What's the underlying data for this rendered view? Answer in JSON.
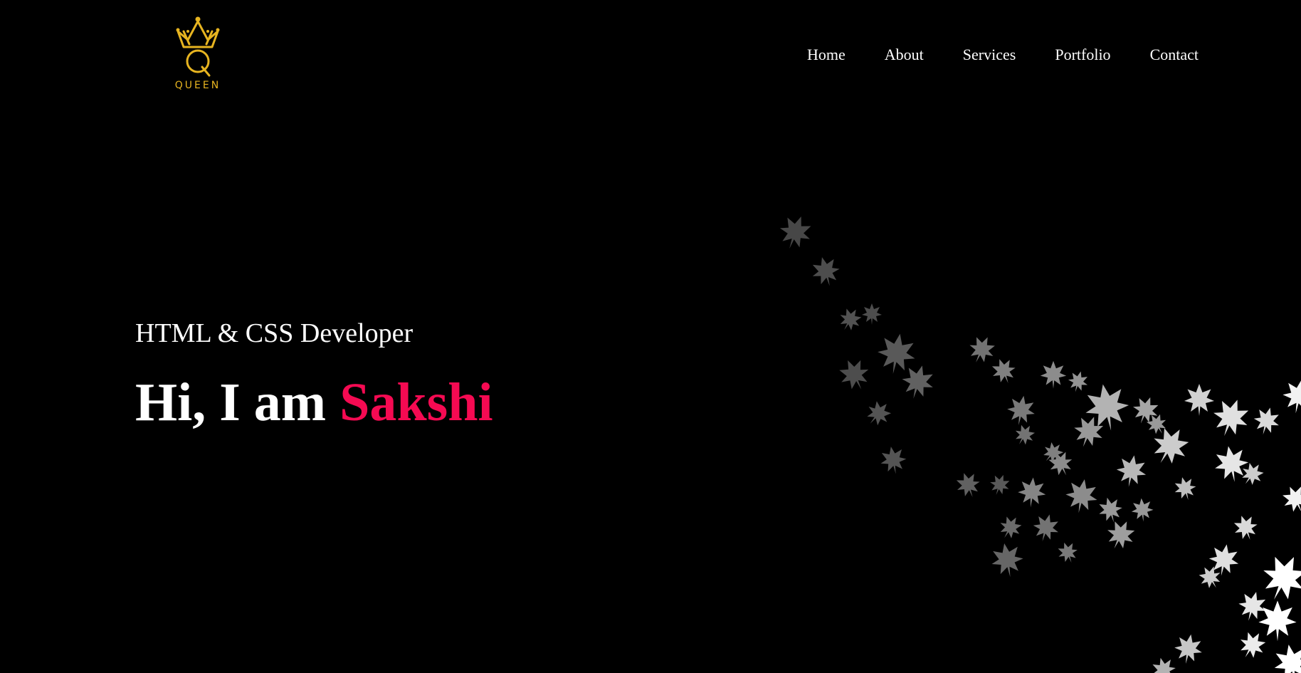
{
  "brand": {
    "logo_icon": "crown-q-icon",
    "logo_text": "QUEEN",
    "logo_color": "#e7b420"
  },
  "nav": {
    "items": [
      {
        "label": "Home"
      },
      {
        "label": "About"
      },
      {
        "label": "Services"
      },
      {
        "label": "Portfolio"
      },
      {
        "label": "Contact"
      }
    ]
  },
  "hero": {
    "subtitle": "HTML & CSS Developer",
    "greeting": "Hi, I am",
    "name": "Sakshi",
    "accent_color": "#f50a52"
  },
  "background": {
    "decoration_icon": "falling-leaves-icon",
    "page_color": "#000000"
  }
}
